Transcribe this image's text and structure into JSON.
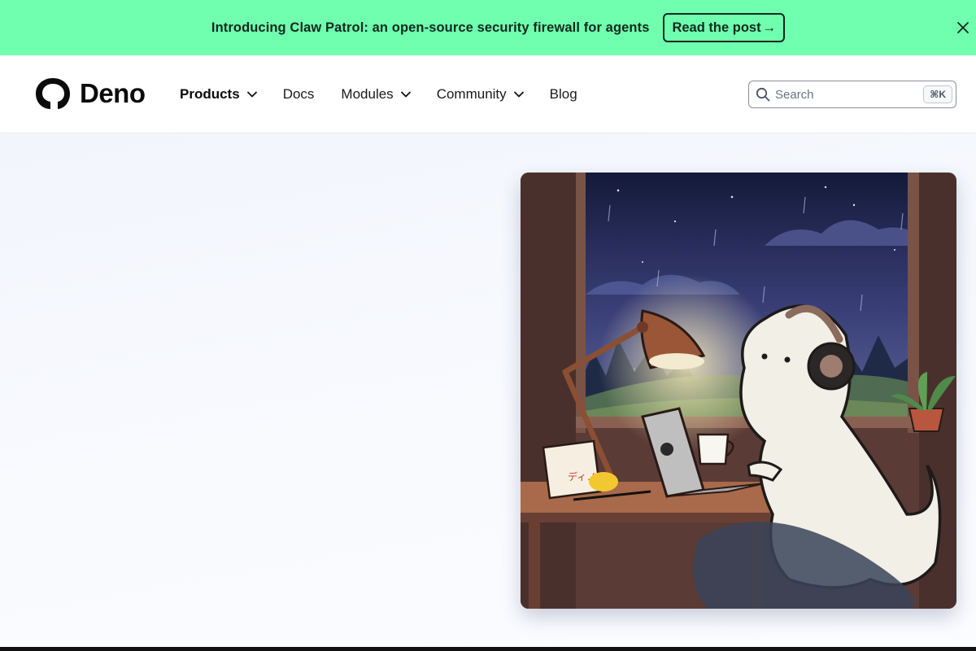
{
  "banner": {
    "text": "Introducing Claw Patrol: an open-source security firewall for agents",
    "button_label": "Read the post",
    "button_arrow": "→",
    "close_icon": "close-icon",
    "background": "#70ffaf"
  },
  "header": {
    "logo_text": "Deno",
    "nav": [
      {
        "label": "Products",
        "dropdown": true
      },
      {
        "label": "Docs",
        "dropdown": false
      },
      {
        "label": "Modules",
        "dropdown": true
      },
      {
        "label": "Community",
        "dropdown": true
      },
      {
        "label": "Blog",
        "dropdown": false
      }
    ],
    "search": {
      "placeholder": "Search",
      "shortcut": "⌘K",
      "icon": "search-icon"
    }
  },
  "hero": {
    "illustration_text": "ディノ"
  },
  "colors": {
    "accent": "#70ffaf",
    "text": "#0b0b0b",
    "hero_bg": "#f4f7fd"
  }
}
